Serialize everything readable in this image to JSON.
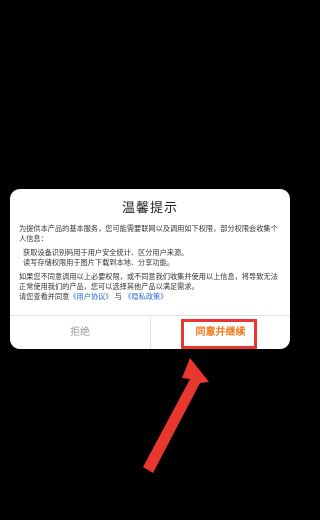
{
  "dialog": {
    "title": "温馨提示",
    "intro": "为提供本产品的基本服务，您可能需要联网以及调用如下权限，部分权限会收集个人信息：",
    "bullets": [
      "获取设备识别码用于用户安全统计、区分用户来源。",
      "读写存储权限用于图片下载到本地、分享功能。"
    ],
    "notice": "如果您不同意调用以上必要权限，或不同意我们收集并使用以上信息，将导致无法正常使用我们的产品，您可以选择其他产品以满足需求。",
    "agreement": {
      "prefix": "请您查看并同意",
      "user_agreement": "《用户协议》",
      "conjunction": "与",
      "privacy_policy": "《隐私政策》"
    },
    "buttons": {
      "reject": "拒绝",
      "agree": "同意并继续"
    }
  },
  "colors": {
    "agree_button": "#f07a1c",
    "highlight_annotation": "#e8372e",
    "link": "#2a6ad8"
  }
}
